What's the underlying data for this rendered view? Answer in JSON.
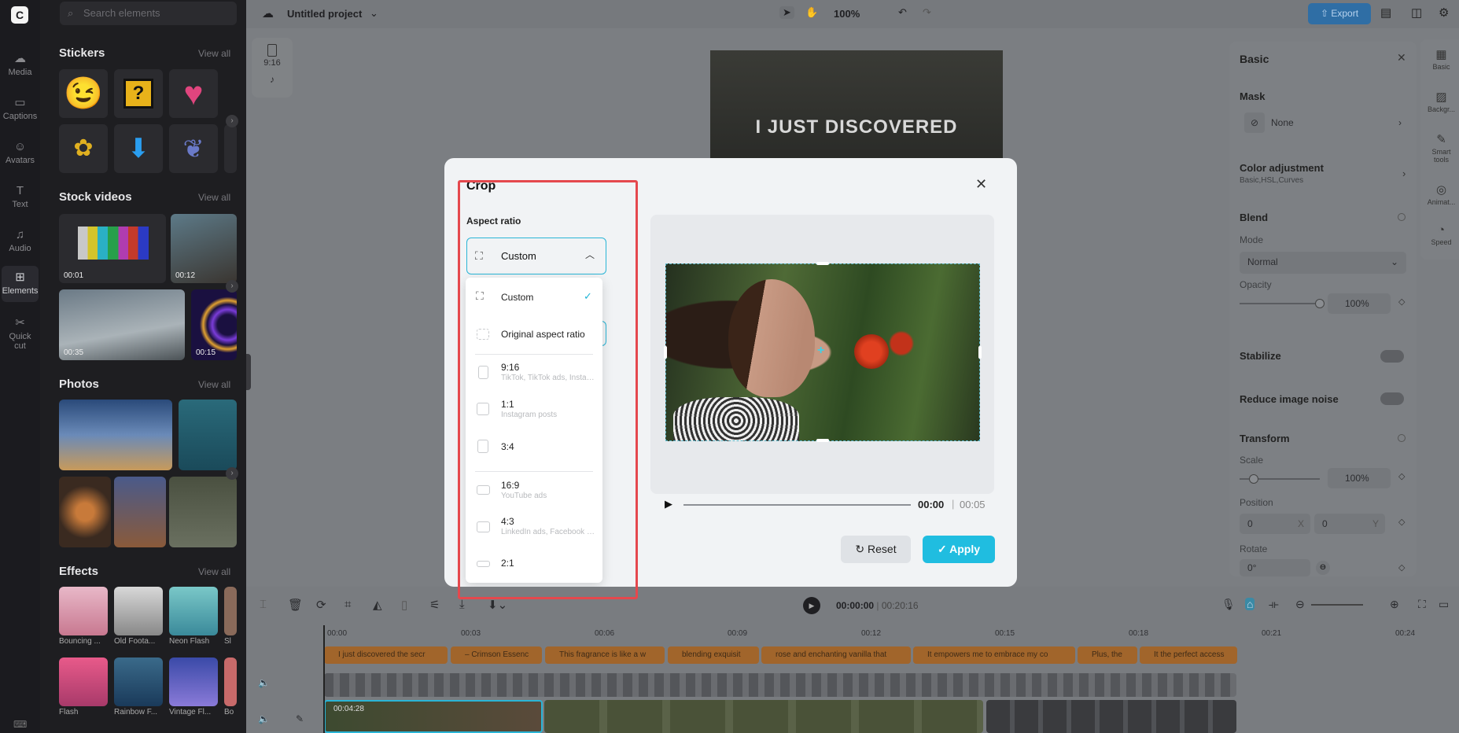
{
  "rail": {
    "items": [
      {
        "label": "Media",
        "icon": "cloud-icon"
      },
      {
        "label": "Captions",
        "icon": "captions-icon"
      },
      {
        "label": "Avatars",
        "icon": "avatar-icon"
      },
      {
        "label": "Text",
        "icon": "text-icon"
      },
      {
        "label": "Audio",
        "icon": "audio-icon"
      },
      {
        "label": "Elements",
        "icon": "elements-icon"
      },
      {
        "label": "Quick cut",
        "icon": "quick-cut-icon"
      }
    ]
  },
  "left_panel": {
    "search_placeholder": "Search elements",
    "stickers_title": "Stickers",
    "stock_videos_title": "Stock videos",
    "photos_title": "Photos",
    "effects_title": "Effects",
    "view_all": "View all",
    "stock_durations": [
      "00:01",
      "00:12",
      "00:35",
      "00:15"
    ],
    "effect_names": [
      "Bouncing ...",
      "Old Foota...",
      "Neon Flash",
      "Sl",
      "Flash",
      "Rainbow F...",
      "Vintage Fl...",
      "Bo"
    ]
  },
  "topbar": {
    "project_name": "Untitled project",
    "zoom": "100%",
    "export_label": "Export"
  },
  "canvas": {
    "caption_text": "I JUST DISCOVERED",
    "ratio_label": "9:16"
  },
  "crop_modal": {
    "title": "Crop",
    "aspect_label": "Aspect ratio",
    "selected": "Custom",
    "options": [
      {
        "label": "Custom",
        "sub": "",
        "checked": true
      },
      {
        "label": "Original aspect ratio",
        "sub": ""
      },
      {
        "label": "9:16",
        "sub": "TikTok, TikTok ads, Instagr..."
      },
      {
        "label": "1:1",
        "sub": "Instagram posts"
      },
      {
        "label": "3:4",
        "sub": ""
      },
      {
        "label": "16:9",
        "sub": "YouTube ads"
      },
      {
        "label": "4:3",
        "sub": "LinkedIn ads, Facebook vid..."
      },
      {
        "label": "2:1",
        "sub": ""
      }
    ],
    "time_current": "00:00",
    "time_separator": "|",
    "time_total": "00:05",
    "reset_label": "Reset",
    "apply_label": "Apply",
    "accent": "#20bde0"
  },
  "right_panel": {
    "title": "Basic",
    "mask_label": "Mask",
    "mask_value": "None",
    "color_adj_label": "Color adjustment",
    "color_adj_sub": "Basic,HSL,Curves",
    "blend_label": "Blend",
    "mode_label": "Mode",
    "mode_value": "Normal",
    "opacity_label": "Opacity",
    "opacity_value": "100%",
    "stabilize_label": "Stabilize",
    "noise_label": "Reduce image noise",
    "transform_label": "Transform",
    "scale_label": "Scale",
    "scale_value": "100%",
    "position_label": "Position",
    "pos_x": "0",
    "pos_x_axis": "X",
    "pos_y": "0",
    "pos_y_axis": "Y",
    "rotate_label": "Rotate",
    "rotate_value": "0°"
  },
  "right_tabs": [
    "Basic",
    "Backgr...",
    "Smart tools",
    "Animat...",
    "Speed"
  ],
  "timeline": {
    "current": "00:00:00",
    "total": "00:20:16",
    "ruler": [
      "00:00",
      "00:03",
      "00:06",
      "00:09",
      "00:12",
      "00:15",
      "00:18",
      "00:21",
      "00:24"
    ],
    "captions": [
      "I just discovered the secr",
      "– Crimson Essenc",
      "This fragrance is like a w",
      "blending exquisit",
      "rose and enchanting vanilla that",
      "It empowers me to embrace my co",
      "Plus, the",
      "It the perfect access"
    ],
    "clip_time": "00:04:28"
  }
}
